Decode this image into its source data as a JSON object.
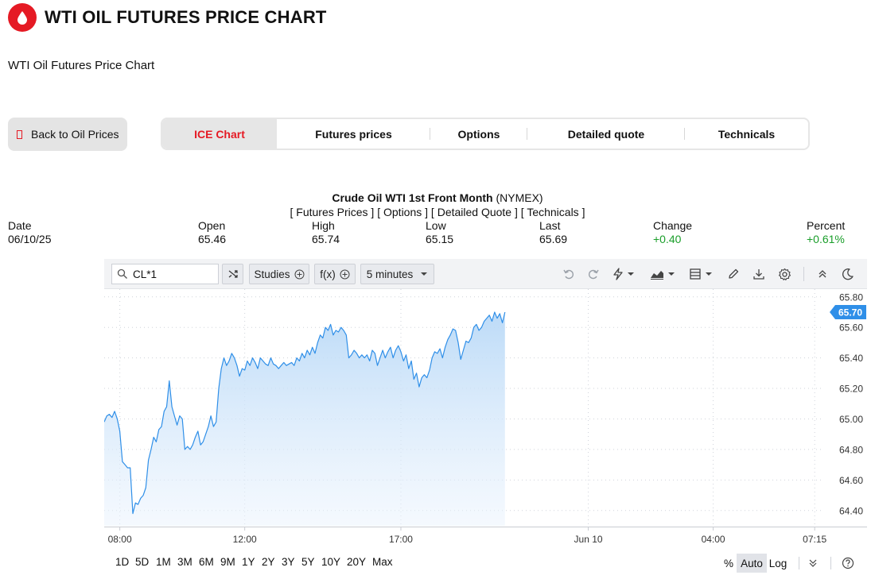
{
  "header": {
    "title": "WTI OIL FUTURES PRICE CHART",
    "subtitle": "WTI Oil Futures Price Chart"
  },
  "back_button": {
    "label": "Back to Oil Prices"
  },
  "tabs": [
    {
      "label": "ICE Chart",
      "active": true
    },
    {
      "label": "Futures prices",
      "active": false
    },
    {
      "label": "Options",
      "active": false
    },
    {
      "label": "Detailed quote",
      "active": false
    },
    {
      "label": "Technicals",
      "active": false
    }
  ],
  "chart_header": {
    "name": "Crude Oil WTI 1st Front Month",
    "exchange": "(NYMEX)",
    "links": [
      "Futures Prices",
      "Options",
      "Detailed Quote",
      "Technicals"
    ]
  },
  "stats": {
    "date": {
      "label": "Date",
      "value": "06/10/25"
    },
    "open": {
      "label": "Open",
      "value": "65.46"
    },
    "high": {
      "label": "High",
      "value": "65.74"
    },
    "low": {
      "label": "Low",
      "value": "65.15"
    },
    "last": {
      "label": "Last",
      "value": "65.69"
    },
    "change": {
      "label": "Change",
      "value": "+0.40"
    },
    "percent": {
      "label": "Percent",
      "value": "+0.61%"
    }
  },
  "toolbar": {
    "symbol": "CL*1",
    "studies_label": "Studies",
    "fx_label": "f(x)",
    "interval_label": "5 minutes",
    "icons": [
      "compare-icon",
      "undo-icon",
      "redo-icon",
      "draw-lightning-icon",
      "chart-type-icon",
      "layout-icon",
      "pencil-icon",
      "download-icon",
      "settings-icon",
      "collapse-icon",
      "dark-mode-icon"
    ]
  },
  "ranges": [
    "1D",
    "5D",
    "1M",
    "3M",
    "6M",
    "9M",
    "1Y",
    "2Y",
    "3Y",
    "5Y",
    "10Y",
    "20Y",
    "Max"
  ],
  "scale": {
    "percent_label": "%",
    "auto_label": "Auto",
    "log_label": "Log",
    "active": "Auto"
  },
  "colors": {
    "brand": "#e51a24",
    "line": "#2f8fe8",
    "positive": "#1a9e2a",
    "last_badge": "#2f8fe8"
  },
  "chart_data": {
    "type": "area",
    "title": "Crude Oil WTI 1st Front Month (NYMEX)",
    "y_ticks": [
      "65.80",
      "65.60",
      "65.40",
      "65.20",
      "65.00",
      "64.80",
      "64.60",
      "64.40"
    ],
    "ylim": [
      64.3,
      65.83
    ],
    "x_ticks": [
      {
        "label": "08:00",
        "x": 6
      },
      {
        "label": "12:00",
        "x": 54
      },
      {
        "label": "17:00",
        "x": 114
      },
      {
        "label": "Jun 10",
        "x": 186
      },
      {
        "label": "04:00",
        "x": 234
      },
      {
        "label": "07:15",
        "x": 273
      }
    ],
    "xlim": [
      0,
      276
    ],
    "last_value": "65.70",
    "points": [
      [
        0,
        64.98
      ],
      [
        1,
        65.02
      ],
      [
        2,
        65.03
      ],
      [
        3,
        65.01
      ],
      [
        4,
        65.05
      ],
      [
        5,
        65.0
      ],
      [
        6,
        64.92
      ],
      [
        7,
        64.72
      ],
      [
        8,
        64.7
      ],
      [
        9,
        64.68
      ],
      [
        10,
        64.68
      ],
      [
        11,
        64.38
      ],
      [
        12,
        64.45
      ],
      [
        13,
        64.44
      ],
      [
        14,
        64.48
      ],
      [
        15,
        64.5
      ],
      [
        16,
        64.55
      ],
      [
        17,
        64.73
      ],
      [
        18,
        64.8
      ],
      [
        19,
        64.88
      ],
      [
        20,
        64.85
      ],
      [
        21,
        64.93
      ],
      [
        22,
        64.95
      ],
      [
        23,
        65.05
      ],
      [
        24,
        65.08
      ],
      [
        25,
        65.25
      ],
      [
        26,
        65.08
      ],
      [
        27,
        65.02
      ],
      [
        28,
        64.96
      ],
      [
        29,
        65.02
      ],
      [
        30,
        65.0
      ],
      [
        31,
        64.8
      ],
      [
        32,
        64.82
      ],
      [
        33,
        64.8
      ],
      [
        34,
        64.83
      ],
      [
        35,
        64.88
      ],
      [
        36,
        64.92
      ],
      [
        37,
        64.83
      ],
      [
        38,
        64.85
      ],
      [
        39,
        64.9
      ],
      [
        40,
        64.95
      ],
      [
        41,
        65.02
      ],
      [
        42,
        64.95
      ],
      [
        43,
        64.98
      ],
      [
        44,
        65.2
      ],
      [
        45,
        65.33
      ],
      [
        46,
        65.4
      ],
      [
        47,
        65.35
      ],
      [
        48,
        65.38
      ],
      [
        49,
        65.43
      ],
      [
        50,
        65.4
      ],
      [
        51,
        65.35
      ],
      [
        52,
        65.28
      ],
      [
        53,
        65.33
      ],
      [
        54,
        65.32
      ],
      [
        55,
        65.38
      ],
      [
        56,
        65.35
      ],
      [
        57,
        65.4
      ],
      [
        58,
        65.37
      ],
      [
        59,
        65.33
      ],
      [
        60,
        65.4
      ],
      [
        61,
        65.38
      ],
      [
        62,
        65.36
      ],
      [
        63,
        65.35
      ],
      [
        64,
        65.4
      ],
      [
        65,
        65.36
      ],
      [
        66,
        65.35
      ],
      [
        67,
        65.33
      ],
      [
        68,
        65.35
      ],
      [
        69,
        65.37
      ],
      [
        70,
        65.35
      ],
      [
        71,
        65.36
      ],
      [
        72,
        65.37
      ],
      [
        73,
        65.35
      ],
      [
        74,
        65.4
      ],
      [
        75,
        65.38
      ],
      [
        76,
        65.43
      ],
      [
        77,
        65.4
      ],
      [
        78,
        65.45
      ],
      [
        79,
        65.42
      ],
      [
        80,
        65.47
      ],
      [
        81,
        65.43
      ],
      [
        82,
        65.5
      ],
      [
        83,
        65.55
      ],
      [
        84,
        65.53
      ],
      [
        85,
        65.6
      ],
      [
        86,
        65.58
      ],
      [
        87,
        65.62
      ],
      [
        88,
        65.55
      ],
      [
        89,
        65.58
      ],
      [
        90,
        65.57
      ],
      [
        91,
        65.6
      ],
      [
        92,
        65.58
      ],
      [
        93,
        65.55
      ],
      [
        94,
        65.4
      ],
      [
        95,
        65.42
      ],
      [
        96,
        65.45
      ],
      [
        97,
        65.43
      ],
      [
        98,
        65.4
      ],
      [
        99,
        65.42
      ],
      [
        100,
        65.4
      ],
      [
        101,
        65.42
      ],
      [
        102,
        65.38
      ],
      [
        103,
        65.45
      ],
      [
        104,
        65.43
      ],
      [
        105,
        65.35
      ],
      [
        106,
        65.4
      ],
      [
        107,
        65.45
      ],
      [
        108,
        65.4
      ],
      [
        109,
        65.44
      ],
      [
        110,
        65.47
      ],
      [
        111,
        65.4
      ],
      [
        112,
        65.45
      ],
      [
        113,
        65.48
      ],
      [
        114,
        65.44
      ],
      [
        115,
        65.38
      ],
      [
        116,
        65.42
      ],
      [
        117,
        65.33
      ],
      [
        118,
        65.38
      ],
      [
        119,
        65.26
      ],
      [
        120,
        65.3
      ],
      [
        121,
        65.21
      ],
      [
        122,
        65.27
      ],
      [
        123,
        65.29
      ],
      [
        124,
        65.27
      ],
      [
        125,
        65.32
      ],
      [
        126,
        65.4
      ],
      [
        127,
        65.44
      ],
      [
        128,
        65.43
      ],
      [
        129,
        65.46
      ],
      [
        130,
        65.4
      ],
      [
        131,
        65.47
      ],
      [
        132,
        65.52
      ],
      [
        133,
        65.55
      ],
      [
        134,
        65.59
      ],
      [
        135,
        65.58
      ],
      [
        136,
        65.5
      ],
      [
        137,
        65.39
      ],
      [
        138,
        65.45
      ],
      [
        139,
        65.51
      ],
      [
        140,
        65.5
      ],
      [
        141,
        65.53
      ],
      [
        142,
        65.6
      ],
      [
        143,
        65.62
      ],
      [
        144,
        65.58
      ],
      [
        145,
        65.6
      ],
      [
        146,
        65.64
      ],
      [
        147,
        65.66
      ],
      [
        148,
        65.68
      ],
      [
        149,
        65.64
      ],
      [
        150,
        65.7
      ],
      [
        151,
        65.66
      ],
      [
        152,
        65.69
      ],
      [
        153,
        65.63
      ],
      [
        154,
        65.7
      ]
    ]
  }
}
